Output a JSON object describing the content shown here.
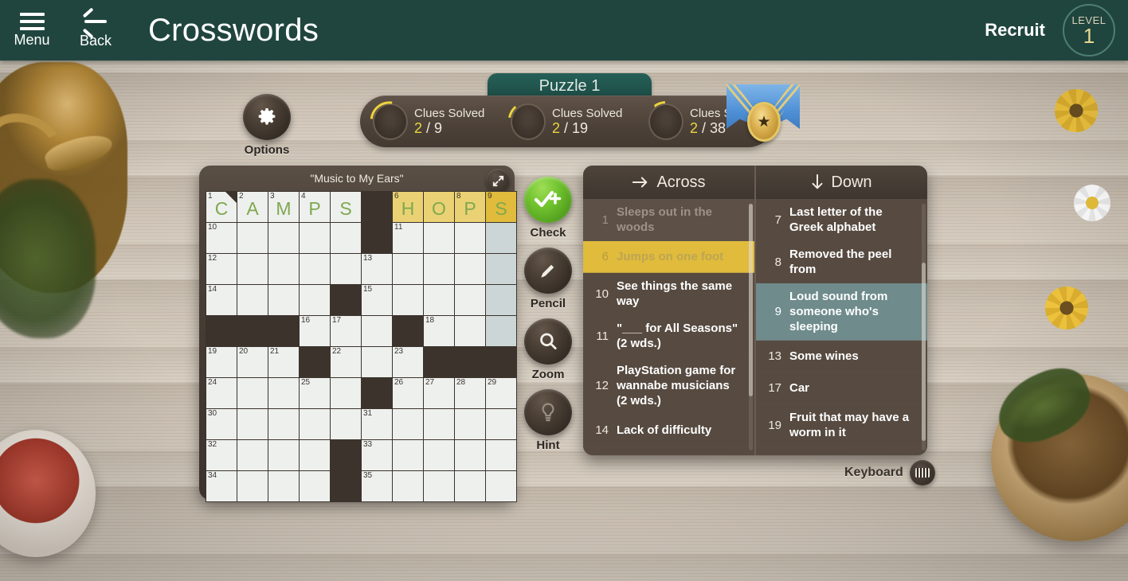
{
  "topbar": {
    "menu_label": "Menu",
    "back_label": "Back",
    "title": "Crosswords",
    "rank": "Recruit",
    "level_word": "LEVEL",
    "level_number": "1",
    "accent_color": "#20453f"
  },
  "puzzle_tab": {
    "label": "Puzzle 1"
  },
  "progress": {
    "items": [
      {
        "title": "Clues Solved",
        "solved": "2",
        "total": "/ 9"
      },
      {
        "title": "Clues Solved",
        "solved": "2",
        "total": "/ 19"
      },
      {
        "title": "Clues Solved",
        "solved": "2",
        "total": "/ 38"
      }
    ],
    "medal_icon": "star-medal-icon"
  },
  "options": {
    "label": "Options",
    "icon": "gear-icon"
  },
  "tools": [
    {
      "label": "Check",
      "icon": "check-plus-icon",
      "color": "#6fc22e"
    },
    {
      "label": "Pencil",
      "icon": "pencil-icon",
      "color": "#4a3f35"
    },
    {
      "label": "Zoom",
      "icon": "magnifier-icon",
      "color": "#4a3f35"
    },
    {
      "label": "Hint",
      "icon": "lightbulb-icon",
      "color": "#4a3f35"
    }
  ],
  "board": {
    "title": "\"Music to My Ears\"",
    "expand_icon": "expand-arrows-icon",
    "columns": 10,
    "rows": 10,
    "letter_color": "#7fa84f",
    "highlight_color": "#ead274",
    "active_color": "#e0bb3c",
    "dim_color": "#ccd6d6",
    "cells": [
      [
        {
          "t": "white",
          "n": "1",
          "l": "C",
          "cursor": true
        },
        {
          "t": "white",
          "n": "2",
          "l": "A"
        },
        {
          "t": "white",
          "n": "3",
          "l": "M"
        },
        {
          "t": "white",
          "n": "4",
          "l": "P"
        },
        {
          "t": "white",
          "l": "S"
        },
        {
          "t": "block"
        },
        {
          "t": "highlight",
          "n": "6",
          "l": "H"
        },
        {
          "t": "highlight",
          "l": "O"
        },
        {
          "t": "highlight",
          "n": "8",
          "l": "P"
        },
        {
          "t": "active",
          "n": "9",
          "l": "S"
        }
      ],
      [
        {
          "t": "white",
          "n": "10"
        },
        {
          "t": "white"
        },
        {
          "t": "white"
        },
        {
          "t": "white"
        },
        {
          "t": "white"
        },
        {
          "t": "block"
        },
        {
          "t": "white",
          "n": "11"
        },
        {
          "t": "white"
        },
        {
          "t": "white"
        },
        {
          "t": "dim"
        }
      ],
      [
        {
          "t": "white",
          "n": "12"
        },
        {
          "t": "white"
        },
        {
          "t": "white"
        },
        {
          "t": "white"
        },
        {
          "t": "white"
        },
        {
          "t": "white",
          "n": "13"
        },
        {
          "t": "white"
        },
        {
          "t": "white"
        },
        {
          "t": "white"
        },
        {
          "t": "dim"
        }
      ],
      [
        {
          "t": "white",
          "n": "14"
        },
        {
          "t": "white"
        },
        {
          "t": "white"
        },
        {
          "t": "white"
        },
        {
          "t": "block"
        },
        {
          "t": "white",
          "n": "15"
        },
        {
          "t": "white"
        },
        {
          "t": "white"
        },
        {
          "t": "white"
        },
        {
          "t": "dim"
        }
      ],
      [
        {
          "t": "block"
        },
        {
          "t": "block"
        },
        {
          "t": "block"
        },
        {
          "t": "white",
          "n": "16"
        },
        {
          "t": "white",
          "n": "17"
        },
        {
          "t": "white"
        },
        {
          "t": "block"
        },
        {
          "t": "white",
          "n": "18"
        },
        {
          "t": "white"
        },
        {
          "t": "dim"
        }
      ],
      [
        {
          "t": "white",
          "n": "19"
        },
        {
          "t": "white",
          "n": "20"
        },
        {
          "t": "white",
          "n": "21"
        },
        {
          "t": "block"
        },
        {
          "t": "white",
          "n": "22"
        },
        {
          "t": "white"
        },
        {
          "t": "white",
          "n": "23"
        },
        {
          "t": "block"
        },
        {
          "t": "block"
        },
        {
          "t": "block"
        }
      ],
      [
        {
          "t": "white",
          "n": "24"
        },
        {
          "t": "white"
        },
        {
          "t": "white"
        },
        {
          "t": "white",
          "n": "25"
        },
        {
          "t": "white"
        },
        {
          "t": "block"
        },
        {
          "t": "white",
          "n": "26"
        },
        {
          "t": "white",
          "n": "27"
        },
        {
          "t": "white",
          "n": "28"
        },
        {
          "t": "white",
          "n": "29"
        }
      ],
      [
        {
          "t": "white",
          "n": "30"
        },
        {
          "t": "white"
        },
        {
          "t": "white"
        },
        {
          "t": "white"
        },
        {
          "t": "white"
        },
        {
          "t": "white",
          "n": "31"
        },
        {
          "t": "white"
        },
        {
          "t": "white"
        },
        {
          "t": "white"
        },
        {
          "t": "white"
        }
      ],
      [
        {
          "t": "white",
          "n": "32"
        },
        {
          "t": "white"
        },
        {
          "t": "white"
        },
        {
          "t": "white"
        },
        {
          "t": "block"
        },
        {
          "t": "white",
          "n": "33"
        },
        {
          "t": "white"
        },
        {
          "t": "white"
        },
        {
          "t": "white"
        },
        {
          "t": "white"
        }
      ],
      [
        {
          "t": "white",
          "n": "34"
        },
        {
          "t": "white"
        },
        {
          "t": "white"
        },
        {
          "t": "white"
        },
        {
          "t": "block"
        },
        {
          "t": "white",
          "n": "35"
        },
        {
          "t": "white"
        },
        {
          "t": "white"
        },
        {
          "t": "white"
        },
        {
          "t": "white"
        }
      ]
    ]
  },
  "clues": {
    "across_header": "Across",
    "down_header": "Down",
    "across_icon": "arrow-right-icon",
    "down_icon": "arrow-down-icon",
    "across": [
      {
        "num": "1",
        "text": "Sleeps out in the woods",
        "state": "solved"
      },
      {
        "num": "6",
        "text": "Jumps on one foot",
        "state": "selected"
      },
      {
        "num": "10",
        "text": "See things the same way",
        "state": "normal"
      },
      {
        "num": "11",
        "text": "\"___ for All Seasons\" (2 wds.)",
        "state": "normal"
      },
      {
        "num": "12",
        "text": "PlayStation game for wannabe musicians (2 wds.)",
        "state": "normal"
      },
      {
        "num": "14",
        "text": "Lack of difficulty",
        "state": "normal"
      }
    ],
    "down": [
      {
        "num": "7",
        "text": "Last letter of the Greek alphabet",
        "state": "normal"
      },
      {
        "num": "8",
        "text": "Removed the peel from",
        "state": "normal"
      },
      {
        "num": "9",
        "text": "Loud sound from someone who's sleeping",
        "state": "selected"
      },
      {
        "num": "13",
        "text": "Some wines",
        "state": "normal"
      },
      {
        "num": "17",
        "text": "Car",
        "state": "normal"
      },
      {
        "num": "19",
        "text": "Fruit that may have a worm in it",
        "state": "normal"
      }
    ]
  },
  "keyboard": {
    "label": "Keyboard",
    "icon": "keyboard-icon"
  }
}
